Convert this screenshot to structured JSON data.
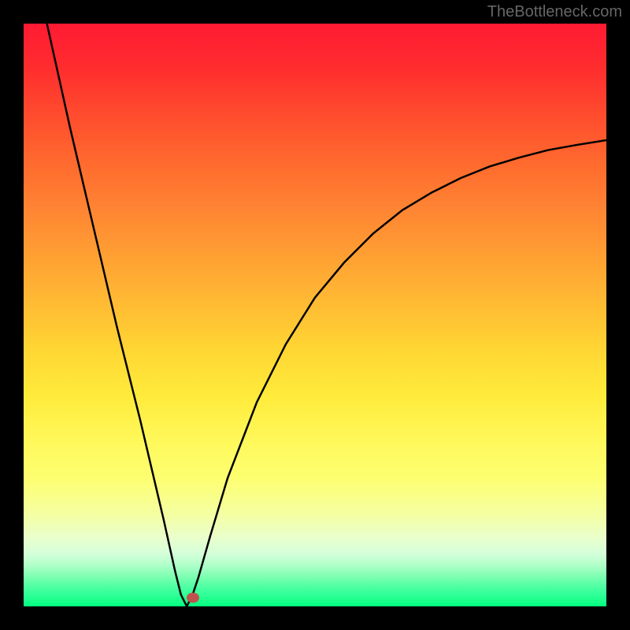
{
  "watermark": "TheBottleneck.com",
  "chart_data": {
    "type": "line",
    "title": "",
    "xlabel": "",
    "ylabel": "",
    "xlim": [
      0,
      100
    ],
    "ylim": [
      0,
      100
    ],
    "curve": {
      "description": "V-shaped bottleneck curve with minimum around x=28",
      "left_branch": {
        "x": [
          4,
          8,
          12,
          16,
          20,
          24,
          26,
          27,
          28
        ],
        "y": [
          100,
          82,
          65,
          48,
          32,
          15,
          6,
          2,
          0
        ]
      },
      "right_branch": {
        "x": [
          28,
          29,
          30,
          32,
          35,
          40,
          45,
          50,
          55,
          60,
          65,
          70,
          75,
          80,
          85,
          90,
          95,
          100
        ],
        "y": [
          0,
          2,
          5,
          12,
          22,
          35,
          45,
          53,
          59,
          64,
          68,
          71,
          73.5,
          75.5,
          77,
          78.3,
          79.2,
          80
        ]
      }
    },
    "marker": {
      "x": 29,
      "y": 1.5,
      "color": "#c0524d"
    },
    "gradient_colors": {
      "top": "#ff1a33",
      "middle": "#ffd633",
      "bottom": "#00ff7f"
    }
  }
}
